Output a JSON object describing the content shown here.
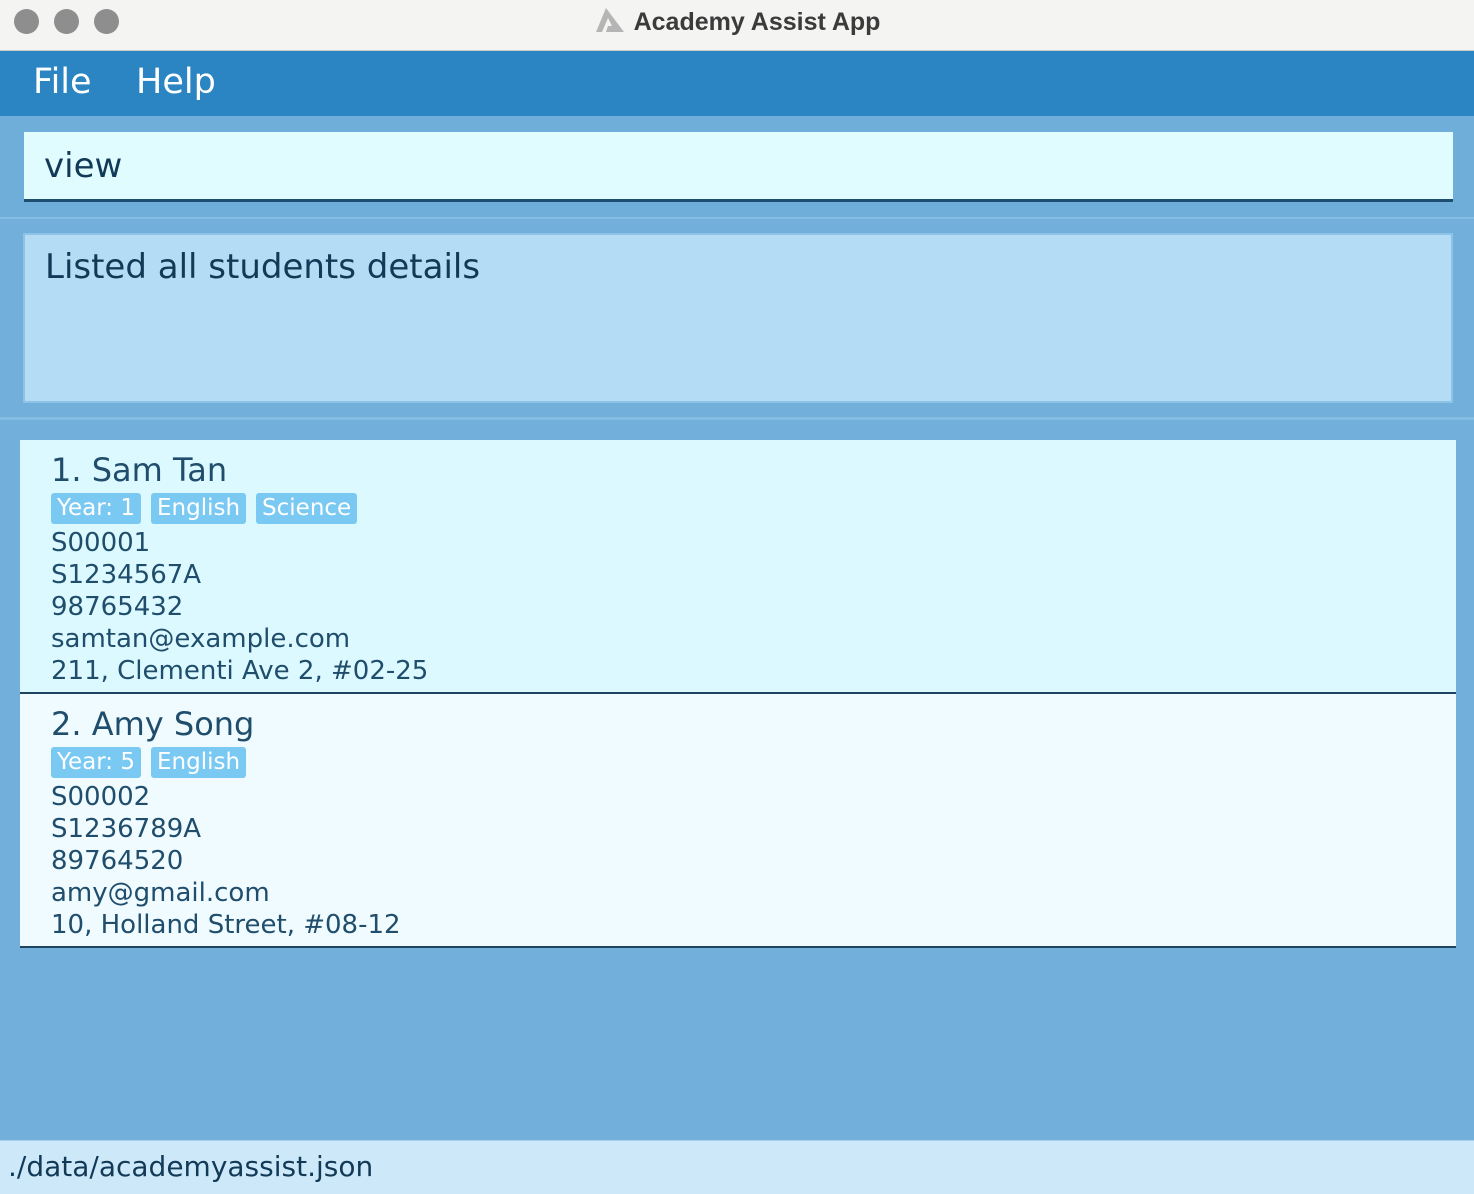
{
  "window": {
    "title": "Academy Assist App"
  },
  "menu": {
    "file": "File",
    "help": "Help"
  },
  "command": {
    "value": "view"
  },
  "result": {
    "message": "Listed all students details"
  },
  "students": [
    {
      "index_name": "1. Sam Tan",
      "tags": [
        "Year: 1",
        "English",
        "Science"
      ],
      "student_id": "S00001",
      "nric": "S1234567A",
      "phone": "98765432",
      "email": "samtan@example.com",
      "address": "211, Clementi Ave 2, #02-25"
    },
    {
      "index_name": "2. Amy Song",
      "tags": [
        "Year: 5",
        "English"
      ],
      "student_id": "S00002",
      "nric": "S1236789A",
      "phone": "89764520",
      "email": "amy@gmail.com",
      "address": "10, Holland Street, #08-12"
    }
  ],
  "status": {
    "file_path": "./data/academyassist.json"
  },
  "colors": {
    "menubar": "#2b85c2",
    "background": "#73afdb",
    "tag": "#7ac9f3"
  }
}
